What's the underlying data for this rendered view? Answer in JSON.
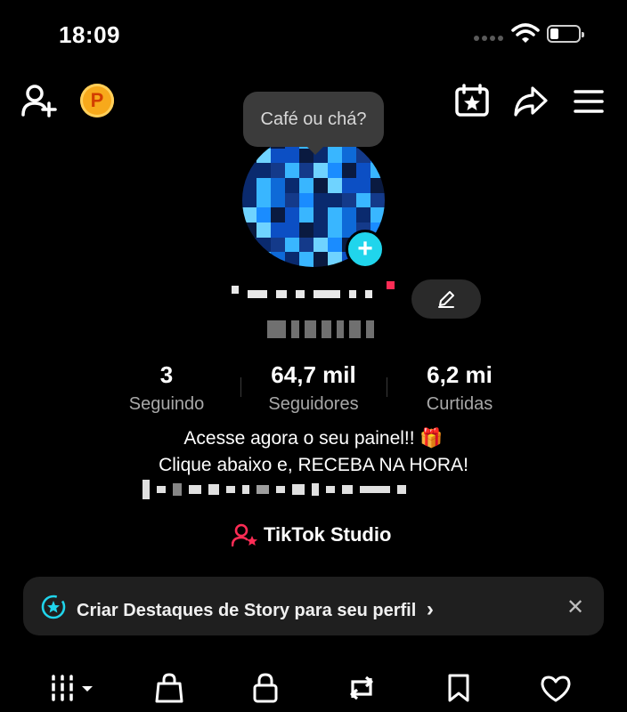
{
  "status_bar": {
    "time": "18:09"
  },
  "header": {
    "coin_label": "P"
  },
  "note_bubble": {
    "text": "Café ou chá?"
  },
  "profile": {
    "stats": [
      {
        "value": "3",
        "label": "Seguindo"
      },
      {
        "value": "64,7 mil",
        "label": "Seguidores"
      },
      {
        "value": "6,2 mi",
        "label": "Curtidas"
      }
    ],
    "bio_line_1": "Acesse agora o seu painel!! 🎁",
    "bio_line_2": "Clique abaixo e, RECEBA NA HORA!",
    "studio_label": "TikTok Studio"
  },
  "banner": {
    "text": "Criar Destaques de Story para seu perfil",
    "chevron": "›",
    "close": "✕"
  },
  "tabs": [
    "videos-tab",
    "shop-tab",
    "private-tab",
    "reposts-tab",
    "saved-tab",
    "liked-tab"
  ],
  "colors": {
    "background": "#000000",
    "accent_cyan": "#20d5ec",
    "accent_pink": "#fe2c55",
    "coin": "#f7a91b"
  }
}
